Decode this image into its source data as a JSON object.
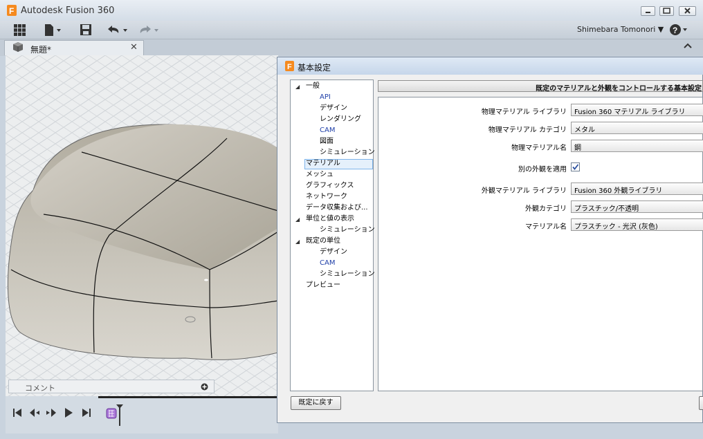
{
  "app": {
    "title": "Autodesk Fusion 360",
    "logo_letter": "F",
    "accent": "#f58a1f"
  },
  "toolbar": {
    "icons": [
      "grid-icon",
      "file-icon",
      "save-icon",
      "undo-icon",
      "redo-icon"
    ],
    "user_name": "Shimebara Tomonori ▼",
    "help_icon": "help-icon"
  },
  "tab": {
    "label": "無題*",
    "close": "✕",
    "collapse": "⌃"
  },
  "comments": {
    "label": "コメント"
  },
  "dialog": {
    "title": "基本設定",
    "header": "既定のマテリアルと外観をコントロールする基本設定",
    "tree": [
      {
        "label": "一般",
        "level": 0,
        "expanded": true
      },
      {
        "label": "API",
        "level": 1,
        "color": "#1f3fa8"
      },
      {
        "label": "デザイン",
        "level": 1
      },
      {
        "label": "レンダリング",
        "level": 1
      },
      {
        "label": "CAM",
        "level": 1,
        "color": "#1f3fa8"
      },
      {
        "label": "図面",
        "level": 1
      },
      {
        "label": "シミュレーション",
        "level": 1
      },
      {
        "label": "マテリアル",
        "level": 0,
        "selected": true
      },
      {
        "label": "メッシュ",
        "level": 0
      },
      {
        "label": "グラフィックス",
        "level": 0
      },
      {
        "label": "ネットワーク",
        "level": 0
      },
      {
        "label": "データ収集および...",
        "level": 0
      },
      {
        "label": "単位と値の表示",
        "level": 0,
        "expanded": true
      },
      {
        "label": "シミュレーション",
        "level": 1
      },
      {
        "label": "既定の単位",
        "level": 0,
        "expanded": true
      },
      {
        "label": "デザイン",
        "level": 1
      },
      {
        "label": "CAM",
        "level": 1,
        "color": "#1f3fa8"
      },
      {
        "label": "シミュレーション",
        "level": 1
      },
      {
        "label": "プレビュー",
        "level": 0
      }
    ],
    "fields": {
      "phys_lib_label": "物理マテリアル ライブラリ",
      "phys_lib_value": "Fusion 360 マテリアル ライブラリ",
      "phys_cat_label": "物理マテリアル カテゴリ",
      "phys_cat_value": "メタル",
      "phys_name_label": "物理マテリアル名",
      "phys_name_value": "鋼",
      "apply_label": "別の外観を適用",
      "apply_checked": true,
      "appr_lib_label": "外観マテリアル ライブラリ",
      "appr_lib_value": "Fusion 360 外観ライブラリ",
      "appr_cat_label": "外観カテゴリ",
      "appr_cat_value": "プラスチック/不透明",
      "mat_name_label": "マテリアル名",
      "mat_name_value": "プラスチック - 光沢 (灰色)"
    },
    "reset_button": "既定に戻す"
  }
}
